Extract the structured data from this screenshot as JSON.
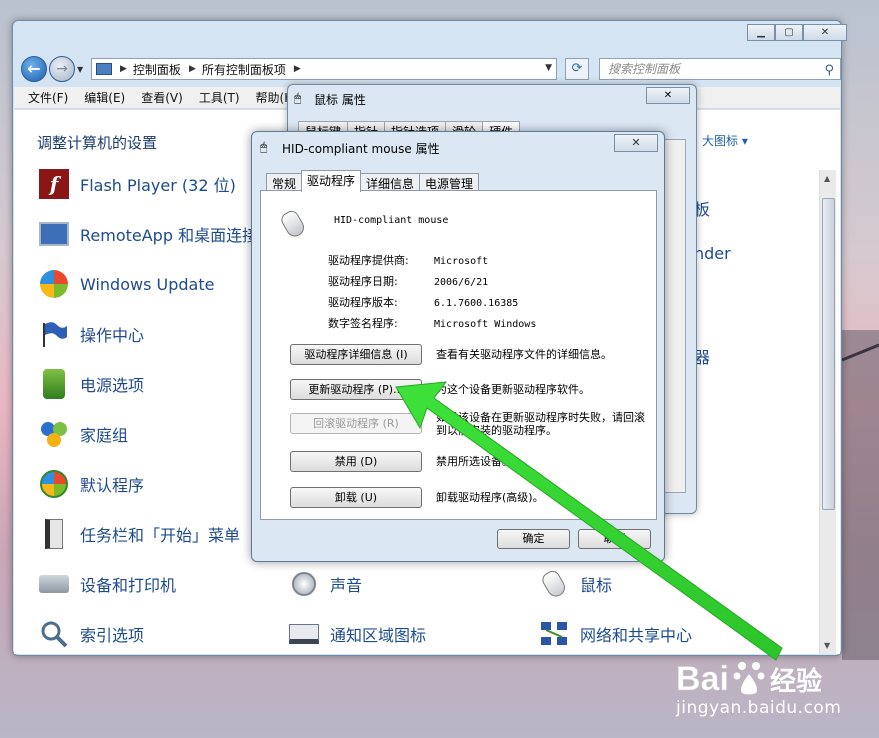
{
  "addressbar": {
    "crumbs": [
      "控制面板",
      "所有控制面板项"
    ],
    "search_placeholder": "搜索控制面板"
  },
  "menubar": [
    "文件(F)",
    "编辑(E)",
    "查看(V)",
    "工具(T)",
    "帮助(H)"
  ],
  "content": {
    "heading": "调整计算机的设置",
    "view_by": "大图标 ▾",
    "items": [
      {
        "label": "Flash Player (32 位)",
        "icon": "flash-icon"
      },
      {
        "label": "RemoteApp 和桌面连接",
        "icon": "remoteapp-icon"
      },
      {
        "label": "Windows Update",
        "icon": "windows-update-icon"
      },
      {
        "label": "操作中心",
        "icon": "action-center-flag-icon"
      },
      {
        "label": "电源选项",
        "icon": "power-options-icon"
      },
      {
        "label": "家庭组",
        "icon": "homegroup-icon"
      },
      {
        "label": "默认程序",
        "icon": "default-programs-icon"
      },
      {
        "label": "任务栏和「开始」菜单",
        "icon": "taskbar-icon"
      },
      {
        "label": "设备和打印机",
        "icon": "printer-icon"
      },
      {
        "label": "索引选项",
        "icon": "index-options-icon"
      },
      {
        "label": "声音",
        "icon": "speaker-icon"
      },
      {
        "label": "通知区域图标",
        "icon": "notification-icon"
      },
      {
        "label": "鼠标",
        "icon": "mouse-icon"
      },
      {
        "label": "网络和共享中心",
        "icon": "network-icon"
      }
    ],
    "right_partial": [
      "板",
      "nder",
      "器"
    ]
  },
  "mouse_dialog": {
    "title": "鼠标 属性",
    "tabs": [
      "鼠标键",
      "指针",
      "指针选项",
      "滑轮",
      "硬件"
    ]
  },
  "hid_dialog": {
    "title": "HID-compliant mouse 属性",
    "tabs": [
      "常规",
      "驱动程序",
      "详细信息",
      "电源管理"
    ],
    "device_name": "HID-compliant mouse",
    "props": [
      {
        "key": "驱动程序提供商:",
        "value": "Microsoft"
      },
      {
        "key": "驱动程序日期:",
        "value": "2006/6/21"
      },
      {
        "key": "驱动程序版本:",
        "value": "6.1.7600.16385"
      },
      {
        "key": "数字签名程序:",
        "value": "Microsoft Windows"
      }
    ],
    "buttons": [
      {
        "label": "驱动程序详细信息 (I)",
        "desc": "查看有关驱动程序文件的详细信息。"
      },
      {
        "label": "更新驱动程序 (P)...",
        "desc": "为这个设备更新驱动程序软件。"
      },
      {
        "label": "回滚驱动程序 (R)",
        "desc": "如果该设备在更新驱动程序时失败，请回滚到以前安装的驱动程序。"
      },
      {
        "label": "禁用 (D)",
        "desc": "禁用所选设备。"
      },
      {
        "label": "卸载 (U)",
        "desc": "卸载驱动程序(高级)。"
      }
    ],
    "ok_label": "确定",
    "cancel_label": "取消"
  },
  "watermark": {
    "brand": "Bai",
    "brand2": "经验",
    "url": "jingyan.baidu.com"
  }
}
